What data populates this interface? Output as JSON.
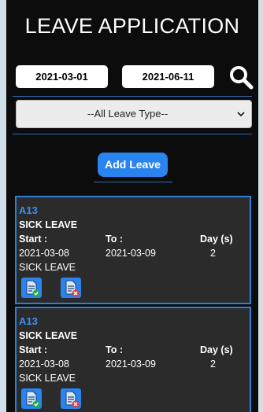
{
  "header": {
    "title": "LEAVE APPLICATION"
  },
  "filters": {
    "date_from": "2021-03-01",
    "date_to": "2021-06-11",
    "leave_type_selected": "--All Leave Type--"
  },
  "actions": {
    "add_label": "Add Leave"
  },
  "applications": [
    {
      "code": "A13",
      "type": "SICK LEAVE",
      "start_label": "Start :",
      "to_label": "To :",
      "days_label": "Day (s)",
      "start": "2021-03-08",
      "end": "2021-03-09",
      "days": "2",
      "reason": "SICK LEAVE"
    },
    {
      "code": "A13",
      "type": "SICK LEAVE",
      "start_label": "Start :",
      "to_label": "To :",
      "days_label": "Day (s)",
      "start": "2021-03-08",
      "end": "2021-03-09",
      "days": "2",
      "reason": "SICK LEAVE"
    }
  ],
  "colors": {
    "accent": "#2a84f0",
    "panel_bg": "#0c0c0c",
    "card_bg": "#2b2b2b",
    "card_border": "#2f7fd6",
    "approve": "#22b04b",
    "reject": "#e03a3a"
  },
  "icons": [
    "search-icon",
    "chevron-down-icon",
    "approve-document-icon",
    "reject-document-icon"
  ]
}
